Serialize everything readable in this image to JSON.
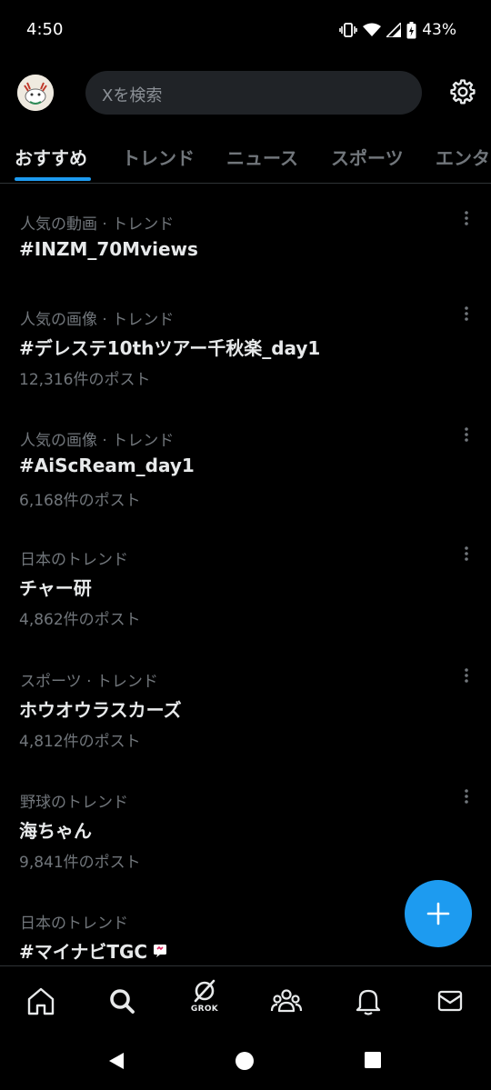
{
  "status_bar": {
    "time": "4:50",
    "battery": "43%"
  },
  "search": {
    "placeholder": "Xを検索"
  },
  "tabs": [
    {
      "label": "おすすめ"
    },
    {
      "label": "トレンド"
    },
    {
      "label": "ニュース"
    },
    {
      "label": "スポーツ"
    },
    {
      "label": "エンタ"
    }
  ],
  "trends": [
    {
      "category": "人気の動画 · トレンド",
      "title": "#INZM_70Mviews",
      "count": ""
    },
    {
      "category": "人気の画像 · トレンド",
      "title": "#デレステ10thツアー千秋楽_day1",
      "count": "12,316件のポスト"
    },
    {
      "category": "人気の画像 · トレンド",
      "title": "#AiScReam_day1",
      "count": "6,168件のポスト"
    },
    {
      "category": "日本のトレンド",
      "title": "チャー研",
      "count": "4,862件のポスト"
    },
    {
      "category": "スポーツ · トレンド",
      "title": "ホウオウラスカーズ",
      "count": "4,812件のポスト"
    },
    {
      "category": "野球のトレンド",
      "title": "海ちゃん",
      "count": "9,841件のポスト"
    },
    {
      "category": "日本のトレンド",
      "title": "#マイナビTGC",
      "count": ""
    }
  ],
  "bottom_nav": {
    "grok_label": "GROK"
  },
  "colors": {
    "accent": "#1d9bf0",
    "background": "#000000",
    "muted": "#71767b"
  }
}
